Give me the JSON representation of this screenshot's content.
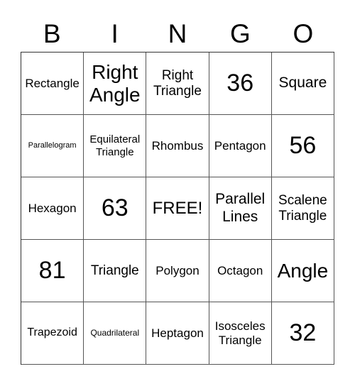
{
  "header": [
    "B",
    "I",
    "N",
    "G",
    "O"
  ],
  "cells": [
    [
      "Rectangle",
      "Right\nAngle",
      "Right\nTriangle",
      "36",
      "Square"
    ],
    [
      "Parallelogram",
      "Equilateral\nTriangle",
      "Rhombus",
      "Pentagon",
      "56"
    ],
    [
      "Hexagon",
      "63",
      "FREE!",
      "Parallel\nLines",
      "Scalene\nTriangle"
    ],
    [
      "81",
      "Triangle",
      "Polygon",
      "Octagon",
      "Angle"
    ],
    [
      "Trapezoid",
      "Quadrilateral",
      "Heptagon",
      "Isosceles\nTriangle",
      "32"
    ]
  ]
}
